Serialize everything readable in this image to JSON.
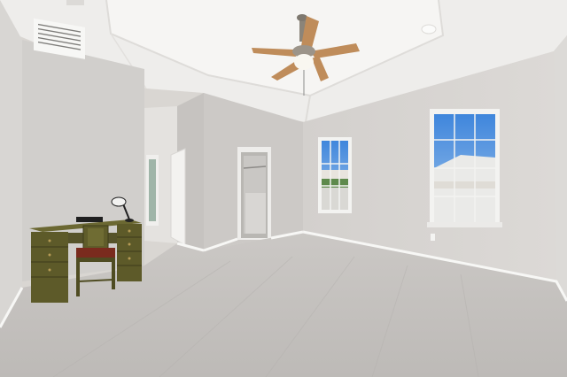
{
  "scene": {
    "subject": "empty-bedroom-interior",
    "colors": {
      "ceiling": "#f1f0ee",
      "tray_ceiling": "#f4f3f1",
      "wall_left": "#d2d0cd",
      "wall_back": "#cfccc9",
      "wall_right": "#d6d3d0",
      "carpet": "#c3c0bd",
      "trim": "#f7f7f5",
      "desk": "#5e5b2a",
      "chair_seat": "#7a2b1e",
      "fan_blade": "#b9875a",
      "sky": "#4f8fdb"
    },
    "objects": [
      "ceiling-fan",
      "air-vent",
      "desk",
      "chair",
      "desk-lamp",
      "closet-door",
      "front-window",
      "side-window",
      "open-door",
      "carpet",
      "baseboard"
    ]
  }
}
